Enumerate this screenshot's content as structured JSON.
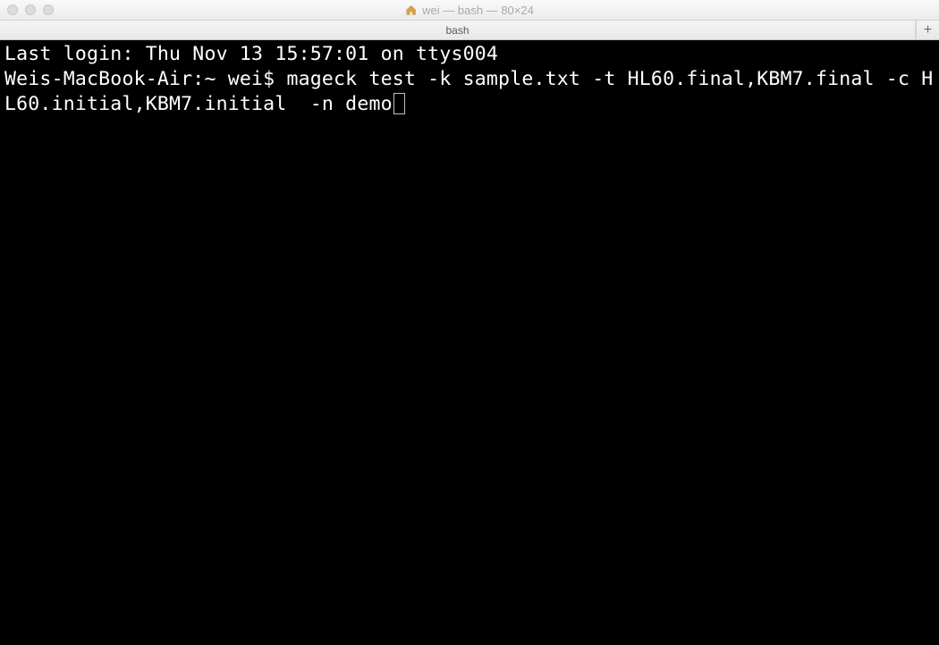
{
  "window": {
    "title": "wei — bash — 80×24"
  },
  "tabs": {
    "active_label": "bash",
    "new_tab_label": "+"
  },
  "terminal": {
    "last_login": "Last login: Thu Nov 13 15:57:01 on ttys004",
    "prompt_and_command": "Weis-MacBook-Air:~ wei$ mageck test -k sample.txt -t HL60.final,KBM7.final -c HL60.initial,KBM7.initial  -n demo"
  }
}
